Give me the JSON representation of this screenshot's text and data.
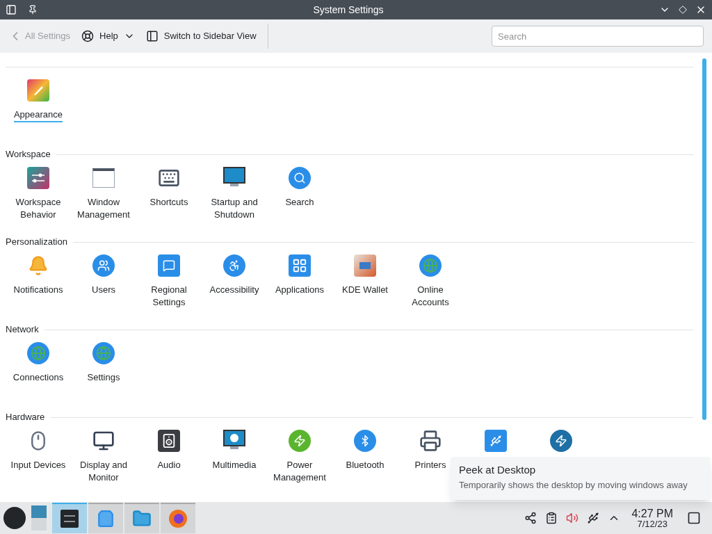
{
  "window": {
    "title": "System Settings"
  },
  "toolbar": {
    "back": {
      "label": "All Settings",
      "disabled": true
    },
    "help": "Help",
    "switch_view": "Switch to Sidebar View",
    "search": {
      "placeholder": "Search"
    }
  },
  "sections": [
    {
      "items": [
        {
          "label": "Appearance",
          "selected": true
        }
      ]
    },
    {
      "title": "Workspace",
      "items": [
        {
          "label": "Workspace Behavior",
          "selected": false
        },
        {
          "label": "Window Management",
          "selected": false
        },
        {
          "label": "Shortcuts",
          "selected": false
        },
        {
          "label": "Startup and Shutdown",
          "selected": false
        },
        {
          "label": "Search",
          "selected": false
        }
      ]
    },
    {
      "title": "Personalization",
      "items": [
        {
          "label": "Notifications",
          "selected": false
        },
        {
          "label": "Users",
          "selected": false
        },
        {
          "label": "Regional Settings",
          "selected": false
        },
        {
          "label": "Accessibility",
          "selected": false
        },
        {
          "label": "Applications",
          "selected": false
        },
        {
          "label": "KDE Wallet",
          "selected": false
        },
        {
          "label": "Online Accounts",
          "selected": false
        }
      ]
    },
    {
      "title": "Network",
      "items": [
        {
          "label": "Connections",
          "selected": false
        },
        {
          "label": "Settings",
          "selected": false
        }
      ]
    },
    {
      "title": "Hardware",
      "items": [
        {
          "label": "Input Devices",
          "selected": false
        },
        {
          "label": "Display and Monitor",
          "selected": false
        },
        {
          "label": "Audio",
          "selected": false
        },
        {
          "label": "Multimedia",
          "selected": false
        },
        {
          "label": "Power Management",
          "selected": false
        },
        {
          "label": "Bluetooth",
          "selected": false
        },
        {
          "label": "Printers",
          "selected": false
        }
      ]
    }
  ],
  "tooltip": {
    "title": "Peek at Desktop",
    "text": "Temporarily shows the desktop by moving windows away"
  },
  "taskbar": {
    "tasks": [
      {
        "active": true
      },
      {
        "active": false
      },
      {
        "active": false
      },
      {
        "active": false
      }
    ],
    "clock": {
      "time": "4:27 PM",
      "date": "7/12/23"
    }
  }
}
